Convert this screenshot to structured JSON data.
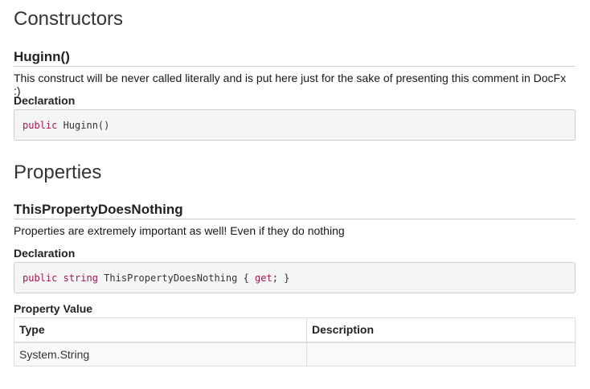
{
  "constructors": {
    "section_title": "Constructors",
    "items": [
      {
        "name": "Huginn()",
        "summary": "This construct will be never called literally and is put here just for the sake of presenting this comment in DocFx :)",
        "declaration_label": "Declaration",
        "code": {
          "keyword": "public",
          "rest": " Huginn()"
        }
      }
    ]
  },
  "properties": {
    "section_title": "Properties",
    "items": [
      {
        "name": "ThisPropertyDoesNothing",
        "summary": "Properties are extremely important as well! Even if they do nothing",
        "declaration_label": "Declaration",
        "code": {
          "keyword1": "public",
          "keyword2": "string",
          "name": " ThisPropertyDoesNothing { ",
          "accessor": "get",
          "tail": "; }"
        },
        "property_value_label": "Property Value",
        "table": {
          "headers": [
            "Type",
            "Description"
          ],
          "rows": [
            [
              "System.String",
              ""
            ]
          ]
        }
      }
    ]
  }
}
